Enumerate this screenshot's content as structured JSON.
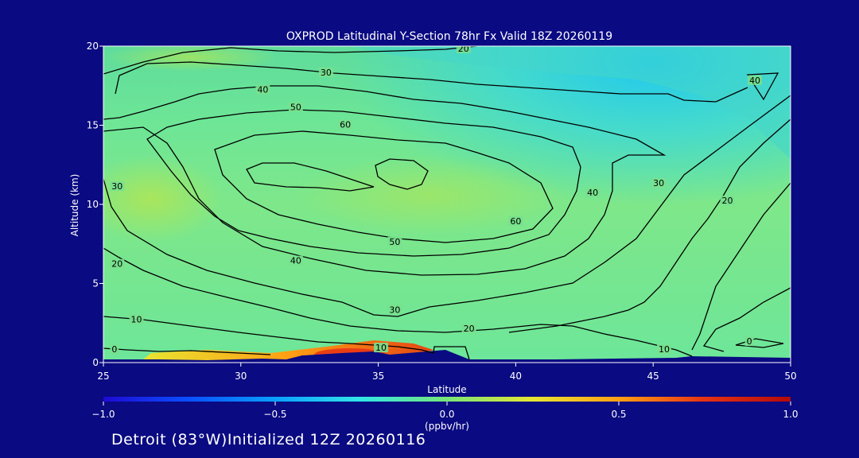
{
  "chart_data": {
    "type": "heatmap",
    "title": "OXPROD Latitudinal Y-Section 78hr  Fx Valid 18Z 20260119",
    "xlabel": "Latitude",
    "ylabel": "Altitude (km)",
    "xlim": [
      25,
      50
    ],
    "ylim": [
      0,
      20
    ],
    "x_ticks": [
      "25",
      "30",
      "35",
      "40",
      "45",
      "50"
    ],
    "y_ticks": [
      "0",
      "5",
      "10",
      "15",
      "20"
    ],
    "colorbar": {
      "label": "(ppbv/hr)",
      "range": [
        -1.0,
        1.0
      ],
      "ticks": [
        "−1.0",
        "−0.5",
        "0.0",
        "0.5",
        "1.0"
      ],
      "colors": [
        "#1e0ad2",
        "#0a50ff",
        "#0aa0ff",
        "#32e6e6",
        "#78e678",
        "#e6e632",
        "#ffa014",
        "#e63214",
        "#b40a0a"
      ]
    },
    "contour_levels": [
      0,
      10,
      20,
      30,
      40,
      50,
      60
    ],
    "contour_labels": [
      {
        "text": "20",
        "x": 38.1,
        "y": 19.8
      },
      {
        "text": "30",
        "x": 33.1,
        "y": 18.3
      },
      {
        "text": "40",
        "x": 30.8,
        "y": 17.2
      },
      {
        "text": "50",
        "x": 32.0,
        "y": 16.1
      },
      {
        "text": "60",
        "x": 33.8,
        "y": 15.0
      },
      {
        "text": "60",
        "x": 40.0,
        "y": 8.9
      },
      {
        "text": "50",
        "x": 35.6,
        "y": 7.6
      },
      {
        "text": "40",
        "x": 32.0,
        "y": 6.4
      },
      {
        "text": "30",
        "x": 35.6,
        "y": 3.3
      },
      {
        "text": "20",
        "x": 38.3,
        "y": 2.1
      },
      {
        "text": "10",
        "x": 35.1,
        "y": 0.9
      },
      {
        "text": "0",
        "x": 25.4,
        "y": 0.8
      },
      {
        "text": "10",
        "x": 26.2,
        "y": 2.7
      },
      {
        "text": "20",
        "x": 25.5,
        "y": 6.2
      },
      {
        "text": "30",
        "x": 25.5,
        "y": 11.1
      },
      {
        "text": "40",
        "x": 42.8,
        "y": 10.7
      },
      {
        "text": "30",
        "x": 45.2,
        "y": 11.3
      },
      {
        "text": "20",
        "x": 47.7,
        "y": 10.2
      },
      {
        "text": "10",
        "x": 45.4,
        "y": 0.8
      },
      {
        "text": "0",
        "x": 48.5,
        "y": 1.3
      },
      {
        "text": "40",
        "x": 48.7,
        "y": 17.8
      }
    ]
  },
  "footer": "Detroit (83°W)Initialized 12Z 20260116"
}
